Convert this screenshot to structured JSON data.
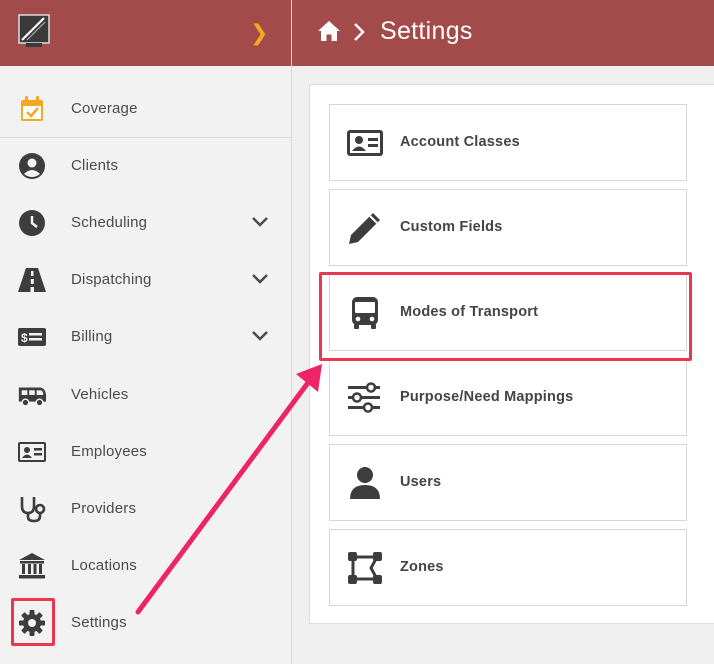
{
  "sidebar": {
    "items": [
      {
        "label": "Coverage"
      },
      {
        "label": "Clients"
      },
      {
        "label": "Scheduling"
      },
      {
        "label": "Dispatching"
      },
      {
        "label": "Billing"
      },
      {
        "label": "Vehicles"
      },
      {
        "label": "Employees"
      },
      {
        "label": "Providers"
      },
      {
        "label": "Locations"
      },
      {
        "label": "Settings"
      }
    ]
  },
  "header": {
    "title": "Settings"
  },
  "settings": {
    "cards": [
      {
        "label": "Account Classes",
        "icon": "id-card-icon"
      },
      {
        "label": "Custom Fields",
        "icon": "pencil-icon"
      },
      {
        "label": "Modes of Transport",
        "icon": "bus-icon"
      },
      {
        "label": "Purpose/Need Mappings",
        "icon": "sliders-icon"
      },
      {
        "label": "Users",
        "icon": "user-icon"
      },
      {
        "label": "Zones",
        "icon": "vector-square-icon"
      }
    ]
  },
  "colors": {
    "header_bg": "#a34b4b",
    "accent_orange": "#f5a623",
    "annotation_red": "#e8384f",
    "arrow_pink": "#ee2468",
    "icon_dark": "#3d3d3d"
  }
}
